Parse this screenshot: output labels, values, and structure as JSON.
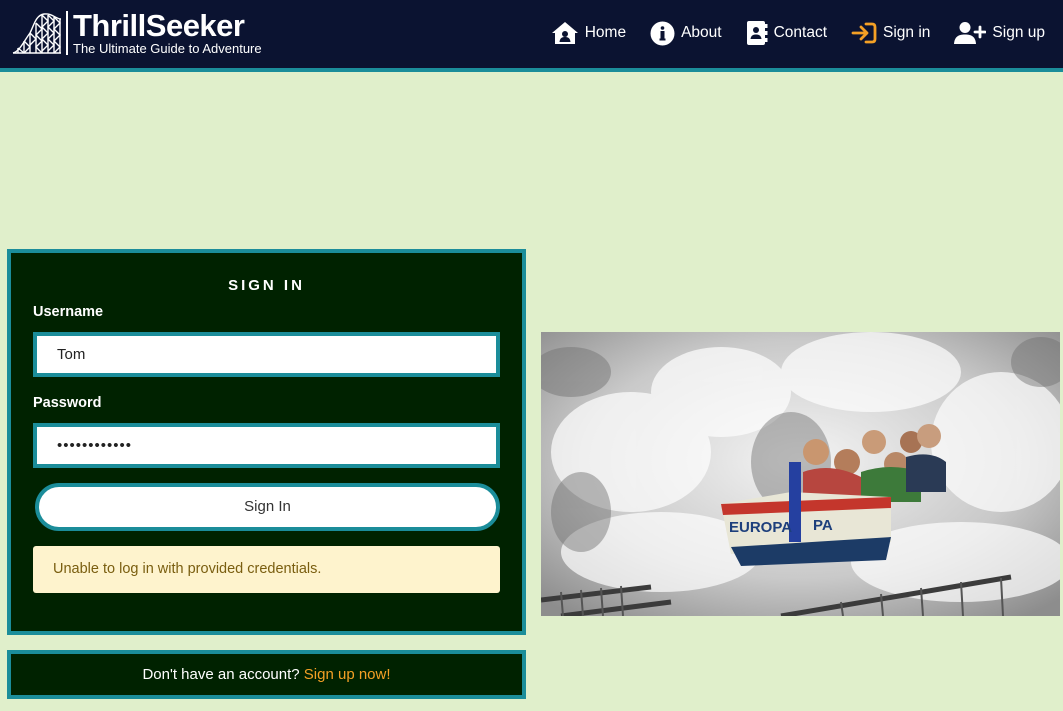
{
  "brand": {
    "title": "ThrillSeeker",
    "tagline": "The Ultimate Guide to Adventure"
  },
  "nav": {
    "items": [
      {
        "label": "Home",
        "icon": "house-user-icon"
      },
      {
        "label": "About",
        "icon": "info-circle-icon"
      },
      {
        "label": "Contact",
        "icon": "address-book-icon"
      },
      {
        "label": "Sign in",
        "icon": "sign-in-arrow-icon",
        "active": true
      },
      {
        "label": "Sign up",
        "icon": "user-plus-icon"
      }
    ]
  },
  "signin": {
    "title": "SIGN IN",
    "username_label": "Username",
    "username_value": "Tom",
    "password_label": "Password",
    "password_value": "••••••••••••",
    "submit_label": "Sign In",
    "error_message": "Unable to log in with provided credentials."
  },
  "signup": {
    "prompt": "Don't have an account?",
    "link": "Sign up now!"
  },
  "colors": {
    "navbar_bg": "#0b1331",
    "accent_teal": "#1b8d9a",
    "card_bg": "#002200",
    "page_bg": "#e0efcb",
    "link_orange": "#f4a025",
    "alert_bg": "#fef3cd"
  }
}
